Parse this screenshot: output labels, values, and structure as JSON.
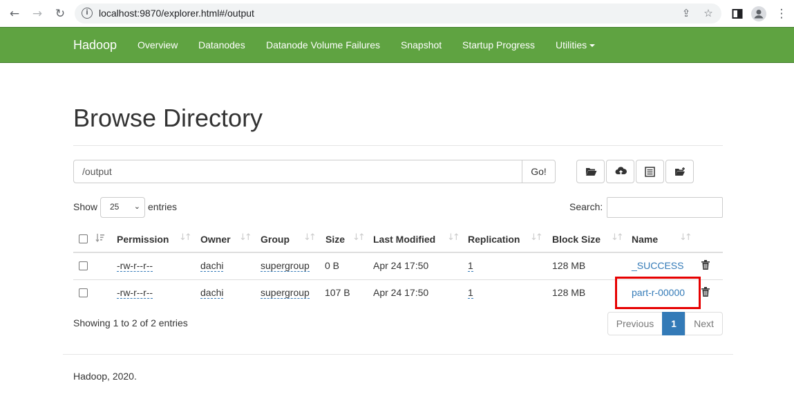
{
  "browser": {
    "url": "localhost:9870/explorer.html#/output",
    "back_glyph": "←",
    "forward_glyph": "→",
    "reload_glyph": "↻",
    "share_glyph": "⇪",
    "star_glyph": "☆",
    "panel_glyph": "▮",
    "menu_glyph": "⋮"
  },
  "navbar": {
    "brand": "Hadoop",
    "items": [
      "Overview",
      "Datanodes",
      "Datanode Volume Failures",
      "Snapshot",
      "Startup Progress",
      "Utilities"
    ],
    "color": "#5fa341"
  },
  "page": {
    "title": "Browse Directory",
    "path_value": "/output",
    "go_label": "Go!",
    "show_label": "Show",
    "entries_select": "25",
    "entries_label": "entries",
    "search_label": "Search:",
    "search_value": "",
    "showing": "Showing 1 to 2 of 2 entries",
    "footer": "Hadoop, 2020."
  },
  "table": {
    "headers": [
      "Permission",
      "Owner",
      "Group",
      "Size",
      "Last Modified",
      "Replication",
      "Block Size",
      "Name"
    ],
    "rows": [
      {
        "permission": "-rw-r--r--",
        "owner": "dachi",
        "group": "supergroup",
        "size": "0 B",
        "modified": "Apr 24 17:50",
        "replication": "1",
        "block_size": "128 MB",
        "name": "_SUCCESS"
      },
      {
        "permission": "-rw-r--r--",
        "owner": "dachi",
        "group": "supergroup",
        "size": "107 B",
        "modified": "Apr 24 17:50",
        "replication": "1",
        "block_size": "128 MB",
        "name": "part-r-00000"
      }
    ]
  },
  "pagination": {
    "previous": "Previous",
    "current": "1",
    "next": "Next"
  },
  "icons": {
    "toolbar": [
      "folder-open-icon",
      "upload-cloud-icon",
      "list-icon",
      "new-folder-icon"
    ],
    "row_action": "trash-icon"
  }
}
